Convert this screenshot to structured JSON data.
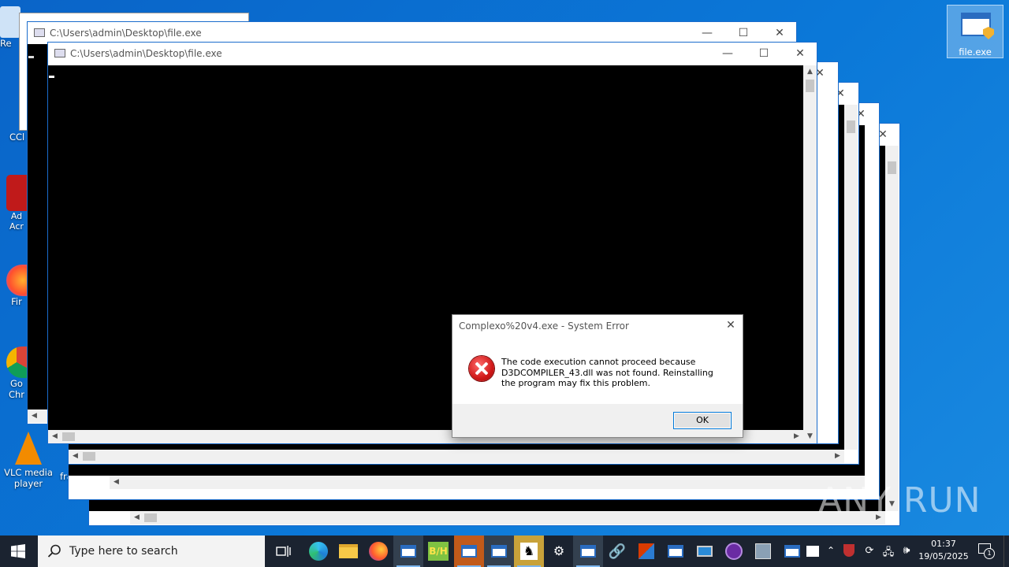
{
  "desktop": {
    "icons": [
      {
        "label": "Re"
      },
      {
        "label": "CCl"
      },
      {
        "label": "Ad Acr"
      },
      {
        "label": "Fir"
      },
      {
        "label": "Go Chr"
      },
      {
        "label": "VLC media player"
      },
      {
        "label": "frame"
      },
      {
        "label": "file.exe"
      }
    ]
  },
  "windows": [
    {
      "title": "C:\\Users\\admin\\Desktop\\file.exe"
    },
    {
      "title": "C:\\Users\\admin\\Desktop\\file.exe"
    }
  ],
  "dialog": {
    "title": "Complexo%20v4.exe - System Error",
    "message": "The code execution cannot proceed because D3DCOMPILER_43.dll was not found. Reinstalling the program may fix this problem.",
    "ok_label": "OK",
    "icon": "error-icon"
  },
  "taskbar": {
    "search_placeholder": "Type here to search",
    "clock_time": "01:37",
    "clock_date": "19/05/2025",
    "notification_count": "1"
  },
  "watermark": "ANY RUN",
  "colors": {
    "desktop_bg": "#0b78d8",
    "taskbar_bg": "#1b2330",
    "window_border": "#1a6ccc"
  }
}
